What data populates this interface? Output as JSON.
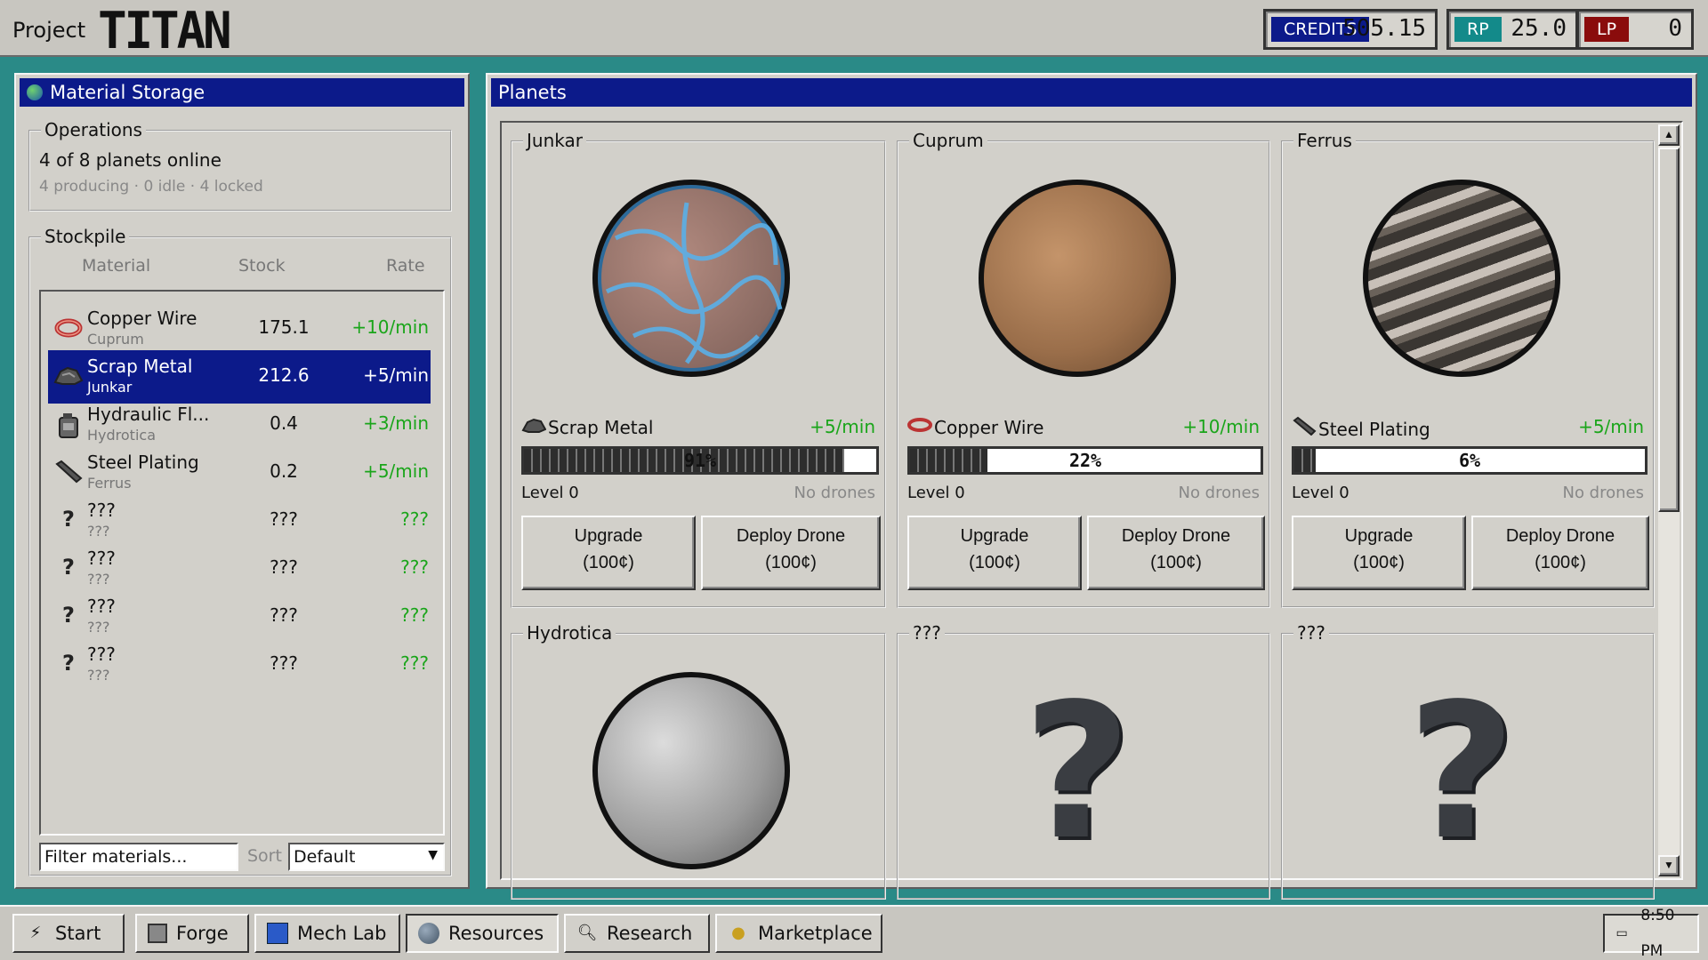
{
  "app": {
    "project_label": "Project",
    "title": "TITAN"
  },
  "currency": [
    {
      "tag": "CREDITS",
      "value": "505.15",
      "color": "#0c1a8a"
    },
    {
      "tag": "RP",
      "value": "25.0",
      "color": "#138a8a"
    },
    {
      "tag": "LP",
      "value": "0",
      "color": "#8a0c0c"
    }
  ],
  "storage": {
    "title": "Material Storage",
    "operations": {
      "label": "Operations",
      "summary": "4 of 8 planets online",
      "detail": "4 producing · 0 idle · 4 locked"
    },
    "stockpile": {
      "label": "Stockpile",
      "columns": [
        "Material",
        "Stock",
        "Rate"
      ],
      "rows": [
        {
          "name": "Copper Wire",
          "source": "Cuprum",
          "stock": "175.1",
          "rate": "+10/min",
          "icon": "copper-wire-icon"
        },
        {
          "name": "Scrap Metal",
          "source": "Junkar",
          "stock": "212.6",
          "rate": "+5/min",
          "icon": "scrap-metal-icon"
        },
        {
          "name": "Hydraulic Fl...",
          "source": "Hydrotica",
          "stock": "0.4",
          "rate": "+3/min",
          "icon": "hydraulic-fluid-icon"
        },
        {
          "name": "Steel Plating",
          "source": "Ferrus",
          "stock": "0.2",
          "rate": "+5/min",
          "icon": "steel-plating-icon"
        },
        {
          "name": "???",
          "source": "???",
          "stock": "???",
          "rate": "???",
          "icon": "unknown-icon"
        },
        {
          "name": "???",
          "source": "???",
          "stock": "???",
          "rate": "???",
          "icon": "unknown-icon"
        },
        {
          "name": "???",
          "source": "???",
          "stock": "???",
          "rate": "???",
          "icon": "unknown-icon"
        },
        {
          "name": "???",
          "source": "???",
          "stock": "???",
          "rate": "???",
          "icon": "unknown-icon"
        }
      ]
    },
    "filter_placeholder": "Filter materials...",
    "sort_label": "Sort",
    "sort_value": "Default"
  },
  "planets": {
    "title": "Planets",
    "cards": [
      {
        "name": "Junkar",
        "material": "Scrap Metal",
        "rate": "+5/min",
        "progress": 91,
        "progress_label": "91%",
        "level": "Level 0",
        "drones": "No drones",
        "upgrade": "Upgrade",
        "upgrade_cost": "(100¢)",
        "deploy": "Deploy Drone",
        "deploy_cost": "(100¢)"
      },
      {
        "name": "Cuprum",
        "material": "Copper Wire",
        "rate": "+10/min",
        "progress": 22,
        "progress_label": "22%",
        "level": "Level 0",
        "drones": "No drones",
        "upgrade": "Upgrade",
        "upgrade_cost": "(100¢)",
        "deploy": "Deploy Drone",
        "deploy_cost": "(100¢)"
      },
      {
        "name": "Ferrus",
        "material": "Steel Plating",
        "rate": "+5/min",
        "progress": 6,
        "progress_label": "6%",
        "level": "Level 0",
        "drones": "No drones",
        "upgrade": "Upgrade",
        "upgrade_cost": "(100¢)",
        "deploy": "Deploy Drone",
        "deploy_cost": "(100¢)"
      },
      {
        "name": "Hydrotica"
      },
      {
        "name": "???"
      },
      {
        "name": "???"
      }
    ]
  },
  "taskbar": {
    "items": [
      "Start",
      "Forge",
      "Mech Lab",
      "Resources",
      "Research",
      "Marketplace"
    ],
    "active": "Resources",
    "clock": "8:50 PM"
  }
}
